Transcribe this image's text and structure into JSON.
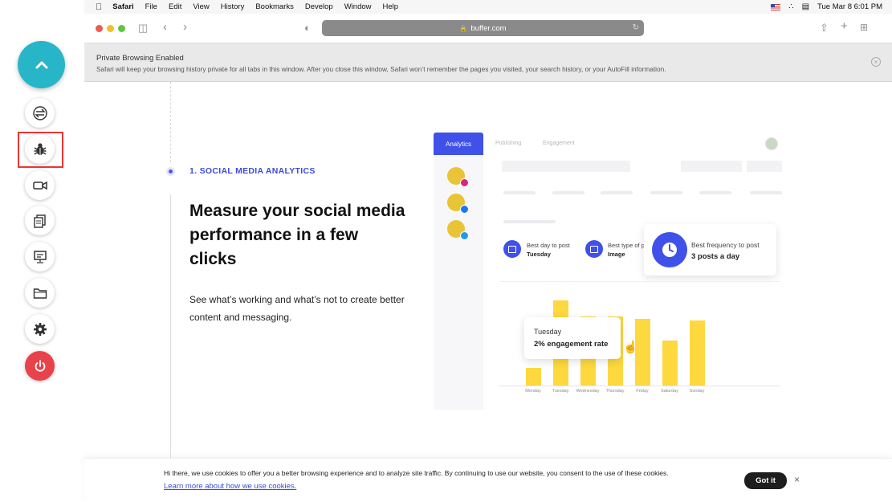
{
  "menubar": {
    "app": "Safari",
    "items": [
      "File",
      "Edit",
      "View",
      "History",
      "Bookmarks",
      "Develop",
      "Window",
      "Help"
    ],
    "datetime": "Tue Mar 8  6:01 PM"
  },
  "browser": {
    "url": "buffer.com",
    "private_title": "Private Browsing Enabled",
    "private_text": "Safari will keep your browsing history private for all tabs in this window. After you close this window, Safari won’t remember the pages you visited, your search history, or your AutoFill information."
  },
  "page": {
    "section_label": "1. SOCIAL MEDIA ANALYTICS",
    "headline": "Measure your social media performance in a few clicks",
    "description": "See what’s working and what’s not to create better content and messaging."
  },
  "mock": {
    "tab_active": "Analytics",
    "tabs": [
      "Publishing",
      "Engagement"
    ],
    "stat1_label": "Best day to post",
    "stat1_value": "Tuesday",
    "stat2_label": "Best type of po",
    "stat2_value": "Image",
    "freq_label": "Best frequency to post",
    "freq_value": "3 posts a day",
    "tooltip_day": "Tuesday",
    "tooltip_value": "2% engagement rate",
    "days": [
      "Monday",
      "Tuesday",
      "Wednesday",
      "Thursday",
      "Friday",
      "Saturday",
      "Sunday"
    ],
    "bar_heights": [
      0.2,
      0.95,
      0.77,
      0.77,
      0.74,
      0.5,
      0.72
    ]
  },
  "cookie": {
    "text": "Hi there, we use cookies to offer you a better browsing experience and to analyze site traffic. By continuing to use our website, you consent to the use of these cookies.",
    "link": "Learn more about how we use cookies",
    "link_suffix": ".",
    "button": "Got it",
    "close": "×"
  },
  "colors": {
    "accent": "#3f51e8",
    "teal": "#27b6c7",
    "bar": "#fdd83f",
    "power": "#e8434a"
  }
}
